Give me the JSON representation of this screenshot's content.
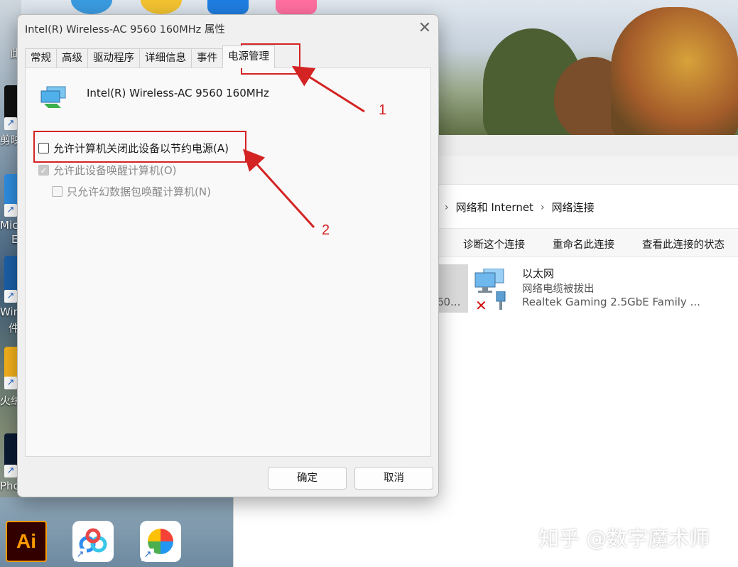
{
  "desktop": {
    "labels": [
      "此",
      "剪映",
      "Mic",
      "E",
      "Wind",
      "件",
      "火绒",
      "Pho"
    ],
    "watermark": "知乎 @数字魔术师"
  },
  "explorer": {
    "breadcrumb": {
      "parent": "网络和 Internet",
      "current": "网络连接"
    },
    "commands": [
      "诊断这个连接",
      "重命名此连接",
      "查看此连接的状态"
    ],
    "selected_truncated": "60...",
    "ethernet": {
      "name": "以太网",
      "status": "网络电缆被拔出",
      "adapter": "Realtek Gaming 2.5GbE Family ..."
    }
  },
  "dialog": {
    "title": "Intel(R) Wireless-AC 9560 160MHz 属性",
    "close_glyph": "✕",
    "tabs": [
      "常规",
      "高级",
      "驱动程序",
      "详细信息",
      "事件",
      "电源管理"
    ],
    "active_tab": "电源管理",
    "device_name": "Intel(R) Wireless-AC 9560 160MHz",
    "options": [
      {
        "label": "允许计算机关闭此设备以节约电源(A)",
        "checked": false,
        "enabled": true
      },
      {
        "label": "允许此设备唤醒计算机(O)",
        "checked": true,
        "enabled": false
      },
      {
        "label": "只允许幻数据包唤醒计算机(N)",
        "checked": false,
        "enabled": false
      }
    ],
    "ok_label": "确定",
    "cancel_label": "取消"
  },
  "annotations": {
    "marker_1": "1",
    "marker_2": "2",
    "color": "#d42323"
  },
  "icons": {
    "device": "network-adapter-icon",
    "ethernet": "ethernet-monitor-icon",
    "disconnected": "red-x-icon",
    "close": "close-icon"
  }
}
